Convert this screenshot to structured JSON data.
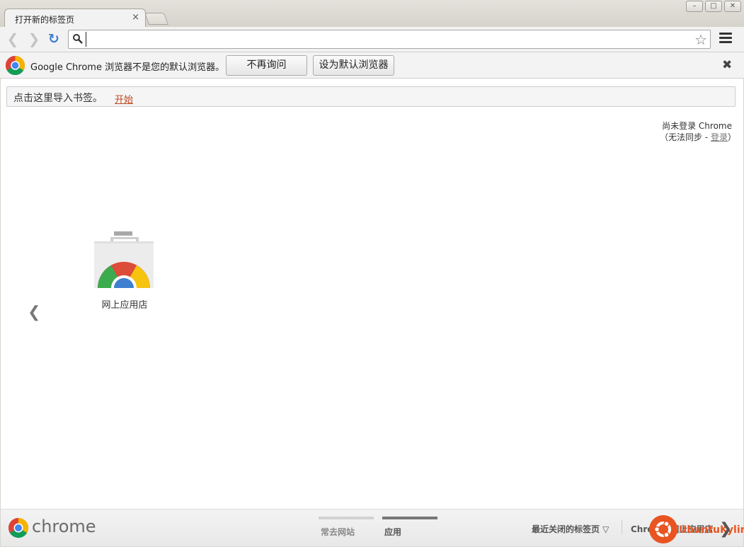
{
  "tab": {
    "title": "打开新的标签页",
    "close": "×"
  },
  "window": {
    "min": "–",
    "max": "□",
    "close": "✕"
  },
  "toolbar": {
    "back": "❮",
    "forward": "❯",
    "reload": "↻",
    "omnibox_value": "",
    "star": "☆"
  },
  "infobar": {
    "message": "Google Chrome 浏览器不是您的默认浏览器。",
    "dont_ask": "不再询问",
    "set_default": "设为默认浏览器",
    "close": "✖"
  },
  "bookmark_bar": {
    "text": "点击这里导入书签。",
    "link": "开始"
  },
  "login": {
    "line1": "尚未登录 Chrome",
    "prefix": "（无法同步 - ",
    "link": "登录",
    "suffix": "）"
  },
  "apps": [
    {
      "label": "网上应用店"
    }
  ],
  "pager": {
    "prev": "❮"
  },
  "footer": {
    "brand": "chrome",
    "tabs": [
      {
        "label": "常去网站",
        "active": false
      },
      {
        "label": "应用",
        "active": true
      }
    ],
    "recent": "最近关闭的标签页 ▽",
    "store": "Chrome 网上应用店",
    "next": "❯"
  },
  "watermark": {
    "text": "UbuntuKylin"
  },
  "colors": {
    "accent": "#3f7fcf",
    "link": "#c0451e",
    "watermark": "#e95420"
  }
}
